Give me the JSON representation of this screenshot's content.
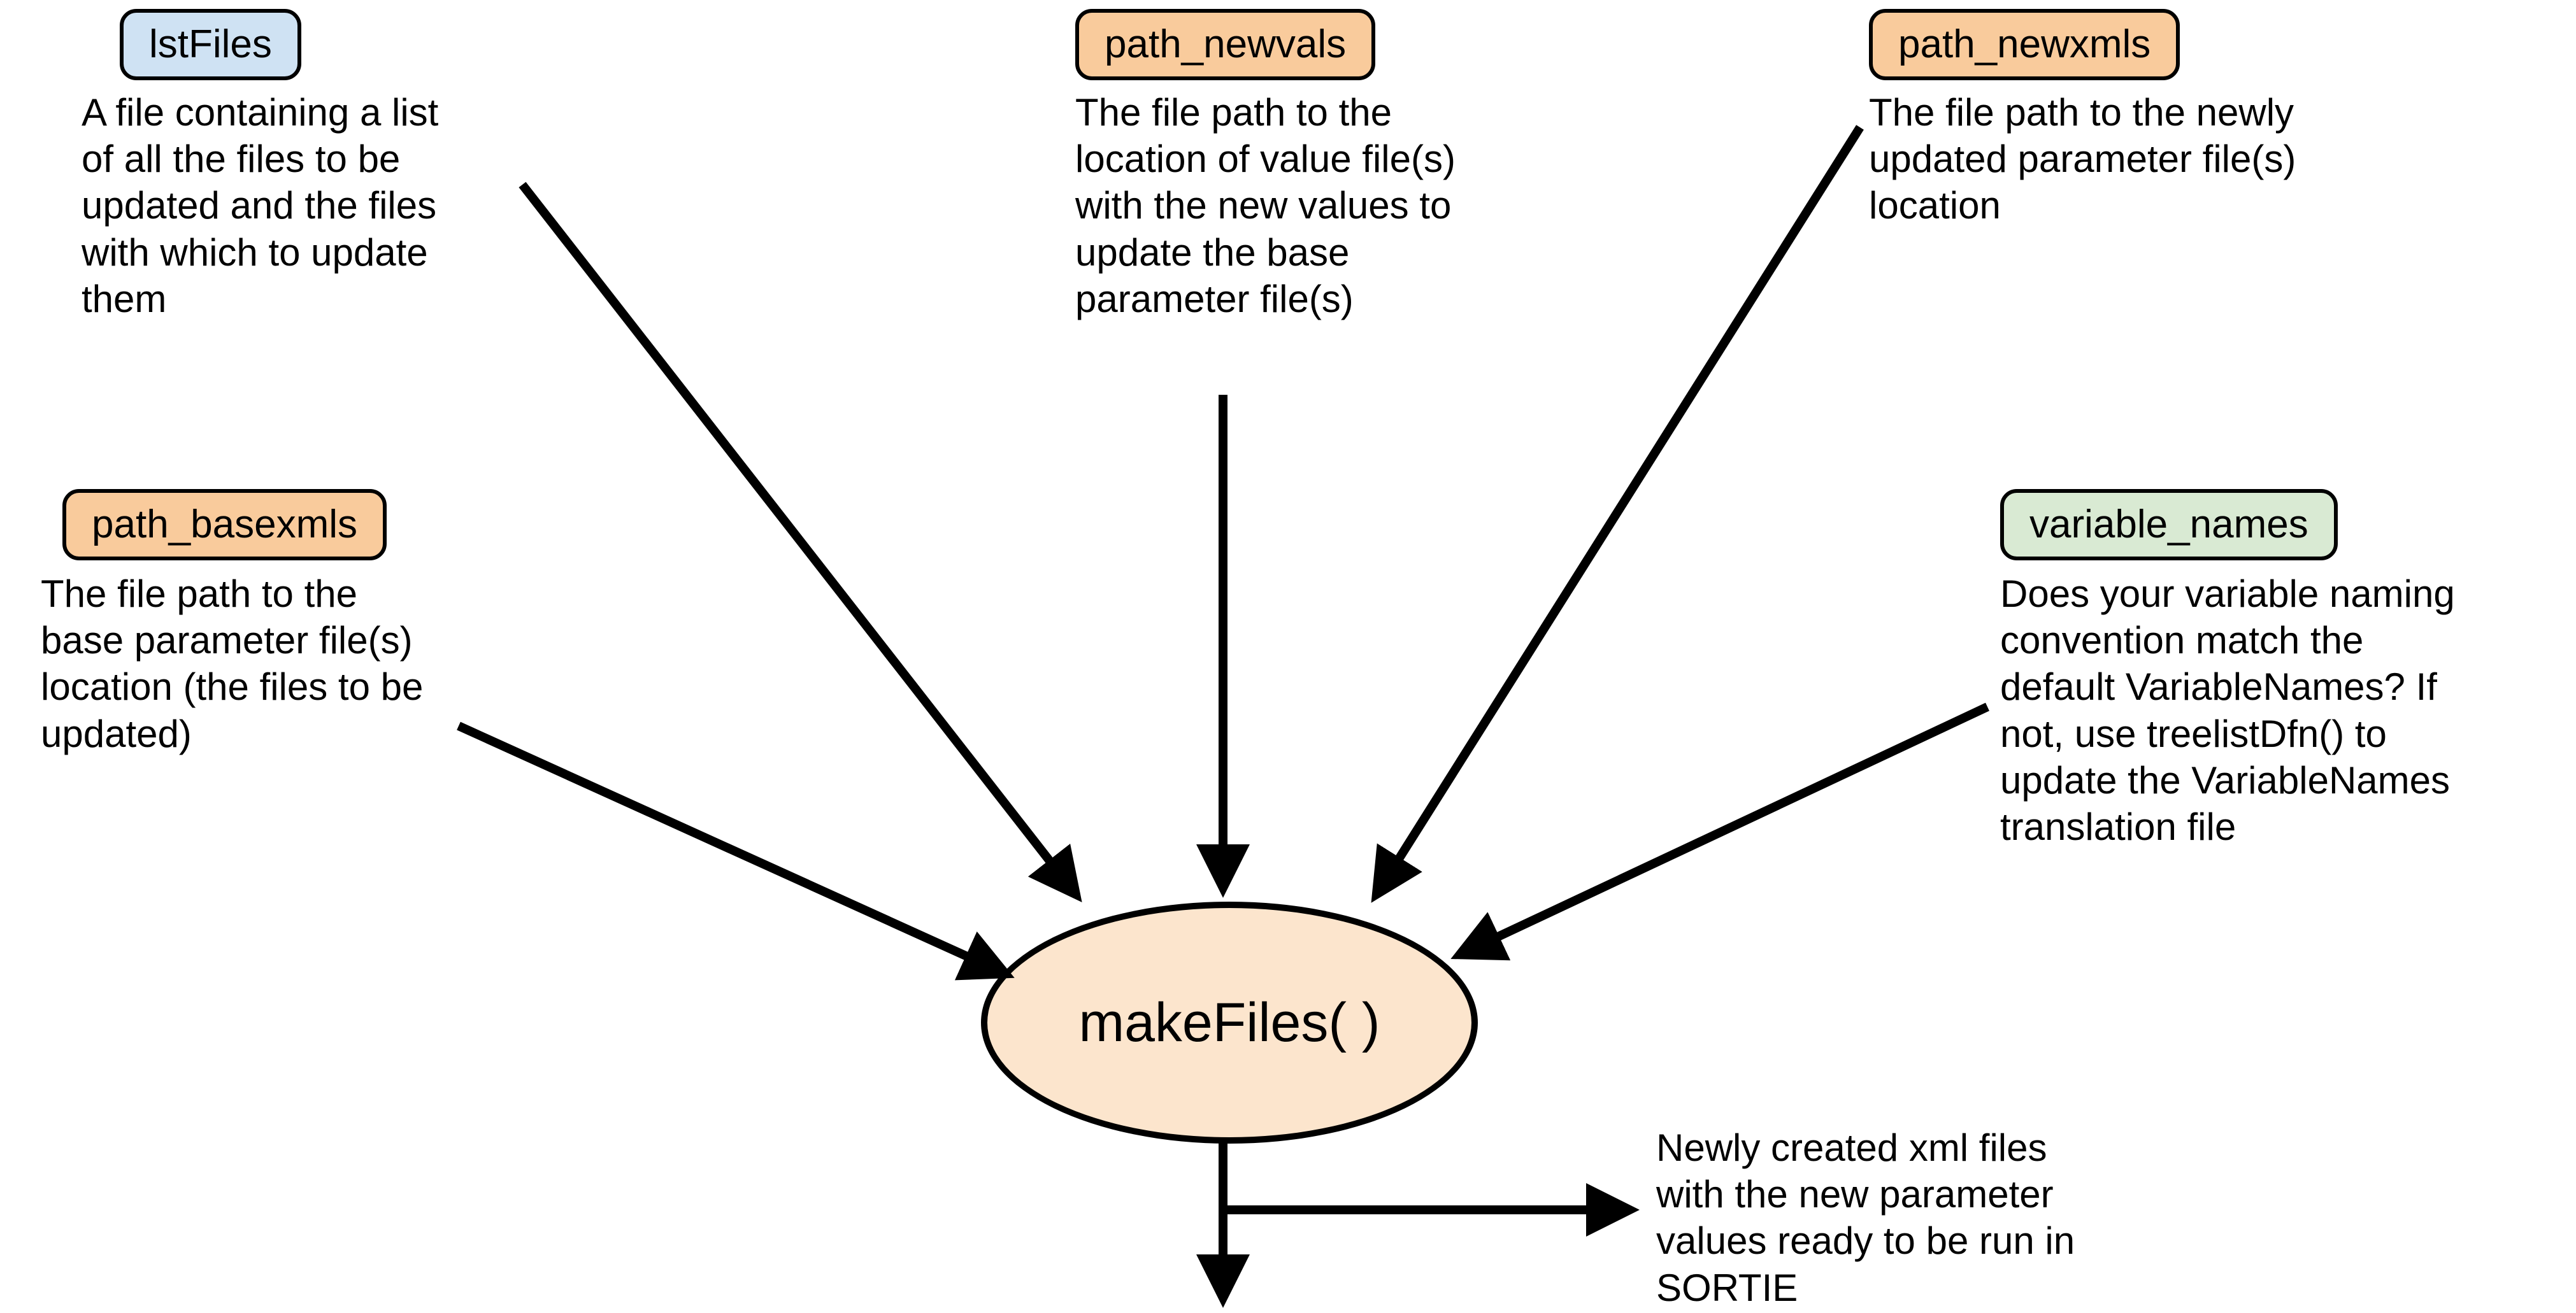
{
  "nodes": {
    "lstFiles": {
      "label": "lstFiles",
      "desc": "A file containing a list of all the files to be updated and the files with which to update them"
    },
    "path_basexmls": {
      "label": "path_basexmls",
      "desc": "The file path to the base parameter file(s) location (the files to be updated)"
    },
    "path_newvals": {
      "label": "path_newvals",
      "desc": "The file path to the location of value file(s) with the new values to update the base parameter file(s)"
    },
    "path_newxmls": {
      "label": "path_newxmls",
      "desc": "The file path to the newly updated parameter file(s) location"
    },
    "variable_names": {
      "label": "variable_names",
      "desc": "Does your variable naming convention match the default VariableNames? If not, use treelistDfn() to update the VariableNames translation file"
    }
  },
  "center": {
    "label": "makeFiles( )"
  },
  "output": {
    "desc": "Newly created xml files with the new parameter values ready to be run in SORTIE"
  }
}
